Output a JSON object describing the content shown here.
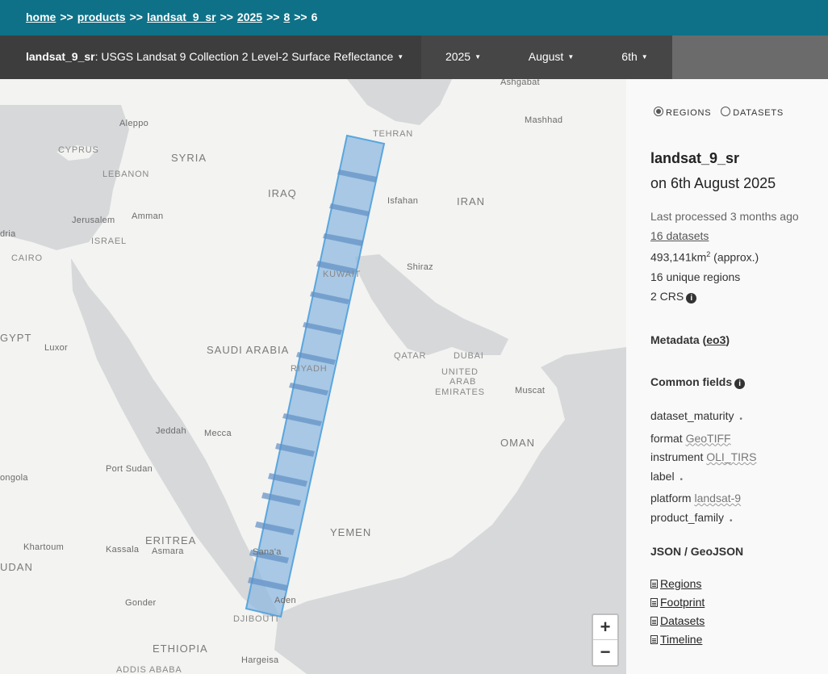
{
  "breadcrumb": {
    "home": "home",
    "products": "products",
    "product": "landsat_9_sr",
    "year": "2025",
    "month": "8",
    "day": "6",
    "separator": ">>"
  },
  "header": {
    "product_code": "landsat_9_sr",
    "product_desc": ": USGS Landsat 9 Collection 2 Level-2 Surface Reflectance",
    "year": "2025",
    "month": "August",
    "day": "6th"
  },
  "map": {
    "labels": {
      "ashgabat": "Ashgabat",
      "aleppo": "Aleppo",
      "mashhad": "Mashhad",
      "cyprus": "CYPRUS",
      "tehran": "TEHRAN",
      "syria": "SYRIA",
      "lebanon": "LEBANON",
      "iraq": "IRAQ",
      "isfahan": "Isfahan",
      "iran": "IRAN",
      "jerusalem": "Jerusalem",
      "amman": "Amman",
      "israel": "ISRAEL",
      "dria": "dria",
      "cairo": "CAIRO",
      "shiraz": "Shiraz",
      "kuwait": "KUWAIT",
      "gypt": "GYPT",
      "luxor": "Luxor",
      "saudi_arabia": "SAUDI ARABIA",
      "qatar": "QATAR",
      "dubai": "DUBAI",
      "riyadh": "RIYADH",
      "uae1": "UNITED",
      "uae2": "ARAB",
      "uae3": "EMIRATES",
      "muscat": "Muscat",
      "jeddah": "Jeddah",
      "mecca": "Mecca",
      "oman": "OMAN",
      "port_sudan": "Port Sudan",
      "dongola": "ongola",
      "yemen": "YEMEN",
      "eritrea": "ERITREA",
      "khartoum": "Khartoum",
      "kassala": "Kassala",
      "asmara": "Asmara",
      "sanaa": "Sana'a",
      "udan": "UDAN",
      "aden": "Aden",
      "gonder": "Gonder",
      "djibouti": "DJIBOUTI",
      "ethiopia": "ETHIOPIA",
      "hargeisa": "Hargeisa",
      "addis": "ADDIS ABABA"
    },
    "zoom_in": "+",
    "zoom_out": "−"
  },
  "panel": {
    "view_regions": "REGIONS",
    "view_datasets": "DATASETS",
    "title": "landsat_9_sr",
    "date": "on 6th August 2025",
    "last_processed": "Last processed 3 months ago",
    "datasets_link": "16 datasets",
    "area": "493,141km",
    "area_sup": "2",
    "area_suffix": " (approx.)",
    "regions": "16 unique regions",
    "crs": "2 CRS",
    "metadata_label": "Metadata (",
    "metadata_link": "eo3",
    "metadata_close": ")",
    "common_fields_label": "Common fields",
    "fields": [
      {
        "name": "dataset_maturity",
        "value": ""
      },
      {
        "name": "format",
        "value": "GeoTIFF"
      },
      {
        "name": "instrument",
        "value": "OLI_TIRS"
      },
      {
        "name": "label",
        "value": ""
      },
      {
        "name": "platform",
        "value": "landsat-9"
      },
      {
        "name": "product_family",
        "value": ""
      }
    ],
    "json_label": "JSON / GeoJSON",
    "links": [
      "Regions",
      "Footprint",
      "Datasets",
      "Timeline"
    ]
  },
  "colors": {
    "topbar": "#0e7187",
    "subbar": "#3d3d3d",
    "footprint_fill": "#8fb9e0",
    "footprint_stroke": "#5aa6dd",
    "water": "#d6d8da",
    "land": "#f3f3f1"
  }
}
